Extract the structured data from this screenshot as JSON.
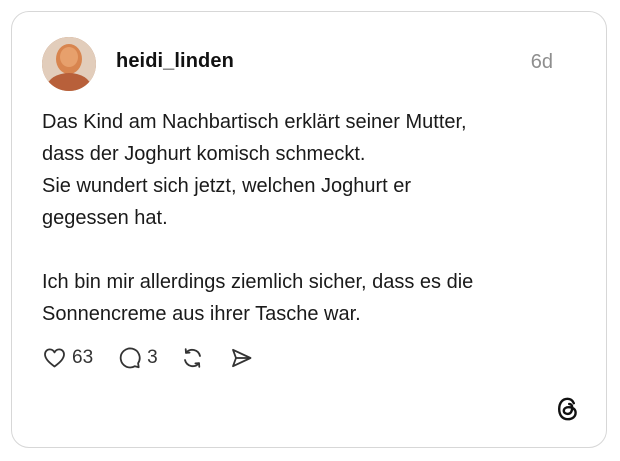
{
  "post": {
    "username": "heidi_linden",
    "timestamp": "6d",
    "text_lines": [
      "Das Kind am Nachbartisch erklärt seiner Mutter,",
      "dass der Joghurt komisch schmeckt.",
      "Sie wundert sich jetzt, welchen Joghurt er",
      "gegessen hat.",
      "",
      "Ich bin mir allerdings ziemlich sicher, dass es die",
      "Sonnencreme aus ihrer Tasche war."
    ],
    "likes": "63",
    "replies": "3"
  },
  "icons": {
    "like": "heart-icon",
    "reply": "comment-icon",
    "repost": "repost-icon",
    "share": "send-icon",
    "brand": "threads-logo-icon"
  },
  "colors": {
    "text": "#1a1a1a",
    "muted": "#8e8e8e",
    "border": "#d7d7d7"
  }
}
